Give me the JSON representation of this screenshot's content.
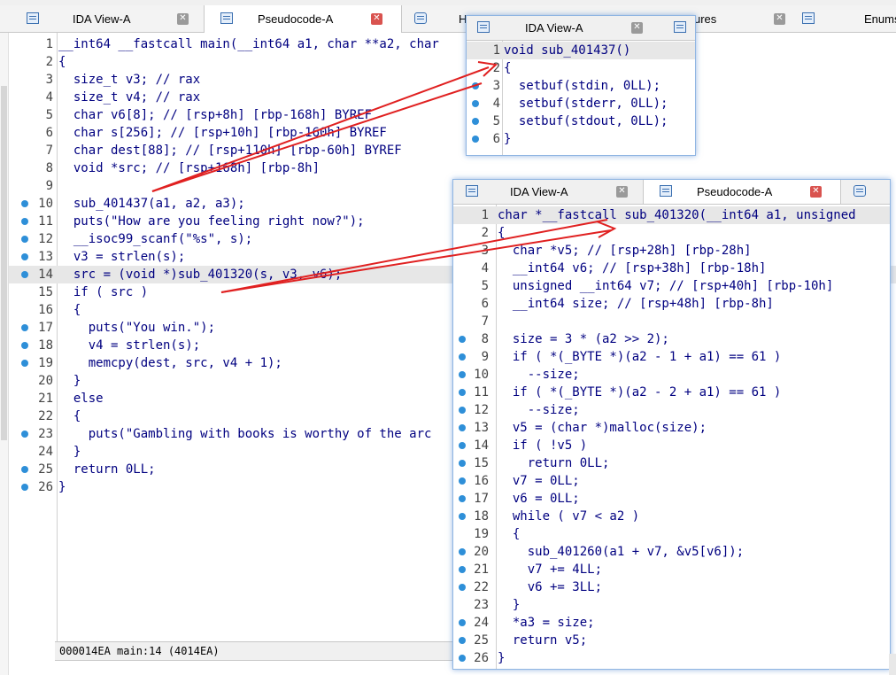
{
  "main_tabs": [
    {
      "label": "IDA View-A"
    },
    {
      "label": "Pseudocode-A"
    },
    {
      "label": "H"
    },
    {
      "label": "ures"
    },
    {
      "label": "Enums"
    }
  ],
  "main_code": [
    {
      "n": "1",
      "text": "__int64 __fastcall main(__int64 a1, char **a2, char"
    },
    {
      "n": "2",
      "text": "{"
    },
    {
      "n": "3",
      "text": "  size_t v3; // rax"
    },
    {
      "n": "4",
      "text": "  size_t v4; // rax"
    },
    {
      "n": "5",
      "text": "  char v6[8]; // [rsp+8h] [rbp-168h] BYREF"
    },
    {
      "n": "6",
      "text": "  char s[256]; // [rsp+10h] [rbp-160h] BYREF"
    },
    {
      "n": "7",
      "text": "  char dest[88]; // [rsp+110h] [rbp-60h] BYREF"
    },
    {
      "n": "8",
      "text": "  void *src; // [rsp+168h] [rbp-8h]"
    },
    {
      "n": "9",
      "text": ""
    },
    {
      "n": "10",
      "text": "  sub_401437(a1, a2, a3);"
    },
    {
      "n": "11",
      "text": "  puts(\"How are you feeling right now?\");"
    },
    {
      "n": "12",
      "text": "  __isoc99_scanf(\"%s\", s);"
    },
    {
      "n": "13",
      "text": "  v3 = strlen(s);"
    },
    {
      "n": "14",
      "text": "  src = (void *)sub_401320(s, v3, v6);"
    },
    {
      "n": "15",
      "text": "  if ( src )"
    },
    {
      "n": "16",
      "text": "  {"
    },
    {
      "n": "17",
      "text": "    puts(\"You win.\");"
    },
    {
      "n": "18",
      "text": "    v4 = strlen(s);"
    },
    {
      "n": "19",
      "text": "    memcpy(dest, src, v4 + 1);"
    },
    {
      "n": "20",
      "text": "  }"
    },
    {
      "n": "21",
      "text": "  else"
    },
    {
      "n": "22",
      "text": "  {"
    },
    {
      "n": "23",
      "text": "    puts(\"Gambling with books is worthy of the arc"
    },
    {
      "n": "24",
      "text": "  }"
    },
    {
      "n": "25",
      "text": "  return 0LL;"
    },
    {
      "n": "26",
      "text": "}"
    }
  ],
  "status_bar": {
    "text": "000014EA main:14 (4014EA)"
  },
  "popup_ida": {
    "tabs": [
      {
        "label": "IDA View-A"
      }
    ],
    "code": [
      {
        "n": "1",
        "text": "void sub_401437()"
      },
      {
        "n": "2",
        "text": "{"
      },
      {
        "n": "3",
        "text": "  setbuf(stdin, 0LL);"
      },
      {
        "n": "4",
        "text": "  setbuf(stderr, 0LL);"
      },
      {
        "n": "5",
        "text": "  setbuf(stdout, 0LL);"
      },
      {
        "n": "6",
        "text": "}"
      }
    ]
  },
  "popup_pseudo": {
    "tabs": [
      {
        "label": "IDA View-A"
      },
      {
        "label": "Pseudocode-A"
      }
    ],
    "code": [
      {
        "n": "1",
        "text": "char *__fastcall sub_401320(__int64 a1, unsigned"
      },
      {
        "n": "2",
        "text": "{"
      },
      {
        "n": "3",
        "text": "  char *v5; // [rsp+28h] [rbp-28h]"
      },
      {
        "n": "4",
        "text": "  __int64 v6; // [rsp+38h] [rbp-18h]"
      },
      {
        "n": "5",
        "text": "  unsigned __int64 v7; // [rsp+40h] [rbp-10h]"
      },
      {
        "n": "6",
        "text": "  __int64 size; // [rsp+48h] [rbp-8h]"
      },
      {
        "n": "7",
        "text": ""
      },
      {
        "n": "8",
        "text": "  size = 3 * (a2 >> 2);"
      },
      {
        "n": "9",
        "text": "  if ( *(_BYTE *)(a2 - 1 + a1) == 61 )"
      },
      {
        "n": "10",
        "text": "    --size;"
      },
      {
        "n": "11",
        "text": "  if ( *(_BYTE *)(a2 - 2 + a1) == 61 )"
      },
      {
        "n": "12",
        "text": "    --size;"
      },
      {
        "n": "13",
        "text": "  v5 = (char *)malloc(size);"
      },
      {
        "n": "14",
        "text": "  if ( !v5 )"
      },
      {
        "n": "15",
        "text": "    return 0LL;"
      },
      {
        "n": "16",
        "text": "  v7 = 0LL;"
      },
      {
        "n": "17",
        "text": "  v6 = 0LL;"
      },
      {
        "n": "18",
        "text": "  while ( v7 < a2 )"
      },
      {
        "n": "19",
        "text": "  {"
      },
      {
        "n": "20",
        "text": "    sub_401260(a1 + v7, &v5[v6]);"
      },
      {
        "n": "21",
        "text": "    v7 += 4LL;"
      },
      {
        "n": "22",
        "text": "    v6 += 3LL;"
      },
      {
        "n": "23",
        "text": "  }"
      },
      {
        "n": "24",
        "text": "  *a3 = size;"
      },
      {
        "n": "25",
        "text": "  return v5;"
      },
      {
        "n": "26",
        "text": "}"
      }
    ]
  },
  "icons": [
    "ida-view-icon",
    "pseudocode-icon",
    "hex-view-icon",
    "structures-icon",
    "enums-icon",
    "close-icon"
  ],
  "colors": {
    "code_text": "#000080",
    "comment": "#7a7a7a",
    "line_dot": "#2e8fd8",
    "arrow": "#e02020",
    "highlight_line": "#e7e7e7",
    "keyword_highlight": "#ffff66"
  }
}
